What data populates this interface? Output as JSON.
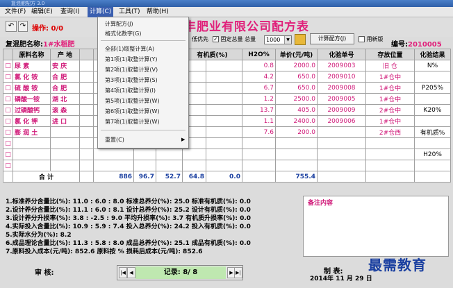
{
  "window": {
    "title": "复混肥配方 3.0"
  },
  "menu": [
    "文件(F)",
    "编辑(E)",
    "查询(I)",
    "计算(C)",
    "工具(T)",
    "帮助(H)"
  ],
  "toolbar": {
    "op_label": "操作: 0/0"
  },
  "company": "丰肥业有限公司配方表",
  "options": {
    "priority": "低优先",
    "fixed_total": "固定总量 总量",
    "total_value": "1000",
    "calc_button": "计算配方(J)",
    "new_version": "用新版"
  },
  "fert": {
    "label": "复混肥名称:",
    "value": "1#水稻肥"
  },
  "code": {
    "label": "编号:",
    "value": "2010005"
  },
  "table": {
    "headers": [
      "原料名称",
      "产 地",
      "",
      "",
      "",
      "%",
      "有机质(%)",
      "",
      "H2O%",
      "单价(元/吨)",
      "化验单号",
      "存放位置",
      "化验结果"
    ],
    "rows": [
      {
        "name": "尿  素",
        "origin": "安  庆",
        "c2": "",
        "c3": "",
        "c4": "",
        "c5": "",
        "organic": "",
        "c7": "",
        "h2o": "0.8",
        "price": "2000.0",
        "lab": "2009003",
        "loc": "旧 仓",
        "result": "N%"
      },
      {
        "name": "氯 化 铵",
        "origin": "合  肥",
        "c2": "",
        "c3": "",
        "c4": "",
        "c5": "",
        "organic": "",
        "c7": "",
        "h2o": "4.2",
        "price": "650.0",
        "lab": "2009010",
        "loc": "1#仓中",
        "result": ""
      },
      {
        "name": "硫 酸 铵",
        "origin": "合  肥",
        "c2": "",
        "c3": "",
        "c4": "",
        "c5": "",
        "organic": "",
        "c7": "",
        "h2o": "6.7",
        "price": "650.0",
        "lab": "2009008",
        "loc": "1#仓中",
        "result": "P205%"
      },
      {
        "name": "磷酸一铵",
        "origin": "湖  北",
        "c2": "",
        "c3": "",
        "c4": "",
        "c5": "",
        "organic": "",
        "c7": "",
        "h2o": "1.2",
        "price": "2500.0",
        "lab": "2009005",
        "loc": "1#仓中",
        "result": ""
      },
      {
        "name": "过磷酸钙",
        "origin": "滚  森",
        "c2": "",
        "c3": "",
        "c4": "",
        "c5": "",
        "organic": "",
        "c7": "",
        "h2o": "13.7",
        "price": "405.0",
        "lab": "2009009",
        "loc": "2#仓中",
        "result": "K20%"
      },
      {
        "name": "氯 化 钾",
        "origin": "进  口",
        "c2": "",
        "c3": "",
        "c4": "",
        "c5": ".0",
        "organic": "",
        "c7": "",
        "h2o": "1.1",
        "price": "2400.0",
        "lab": "2009006",
        "loc": "1#仓中",
        "result": ""
      },
      {
        "name": "膨 润 土",
        "origin": "",
        "c2": "",
        "c3": "",
        "c4": "",
        "c5": "",
        "organic": "",
        "c7": "",
        "h2o": "7.6",
        "price": "200.0",
        "lab": "",
        "loc": "2#仓西",
        "result": "有机质%"
      },
      {
        "name": "",
        "origin": "",
        "c2": "",
        "c3": "",
        "c4": "",
        "c5": "",
        "organic": "",
        "c7": "",
        "h2o": "",
        "price": "",
        "lab": "",
        "loc": "",
        "result": ""
      },
      {
        "name": "",
        "origin": "",
        "c2": "",
        "c3": "",
        "c4": "",
        "c5": "",
        "organic": "",
        "c7": "",
        "h2o": "",
        "price": "",
        "lab": "",
        "loc": "",
        "result": "H20%"
      },
      {
        "name": "",
        "origin": "",
        "c2": "",
        "c3": "",
        "c4": "",
        "c5": "",
        "organic": "",
        "c7": "",
        "h2o": "",
        "price": "",
        "lab": "",
        "loc": "",
        "result": ""
      }
    ],
    "sum": {
      "label": "合    计",
      "c2": "886",
      "c3": "96.7",
      "c4": "52.7",
      "c5": "64.8",
      "organic": "0.0",
      "price": "755.4"
    }
  },
  "calc_menu": {
    "items": [
      "计算配方(J)",
      "格式化数字(G)",
      "全部(1)取整计算(A)",
      "第1项(1)取整计算(Y)",
      "第2项(1)取整计算(V)",
      "第3项(1)取整计算(S)",
      "第4项(1)取整计算(I)",
      "第5项(1)取整计算(W)",
      "第6项(1)取整计算(W)",
      "第7项(1)取整计算(W)",
      "重置(C)"
    ]
  },
  "summary": [
    "1.标准养分含量比(%): 11.0 : 6.0 : 8.0 标准总养分(%):   25.0  标准有机质(%):   0.0",
    "2.设计养分含量比(%): 11.1 : 6.0 : 8.1 设计总养分(%):   25.2  设计有机质(%):   0.0",
    "3.设计养分升损率(%): 3.8 : -2.5 : 9.0 平均升损率(%):    3.7  有机质升损率(%): 0.0",
    "4.实际投入含量比(%): 10.9 : 5.9 : 7.4 投入总养分(%):   24.2  投入有机质(%):   0.0",
    "5.实际水分为(%):     8.2",
    "6.成品理论含量比(%): 11.3 : 5.8 : 8.0 成品总养分(%):   25.1  成品有机质(%):   0.0",
    "7.原料投入成本(元/吨):   852.6       原料按         % 损耗后成本(元/吨):   852.6"
  ],
  "notes_label": "备注内容",
  "footer": {
    "audit": "审    核:",
    "record": "记录:   8/ 8",
    "maker": "制    表:",
    "date": "2014年   11 月  29 日"
  },
  "watermark": "最需教育"
}
